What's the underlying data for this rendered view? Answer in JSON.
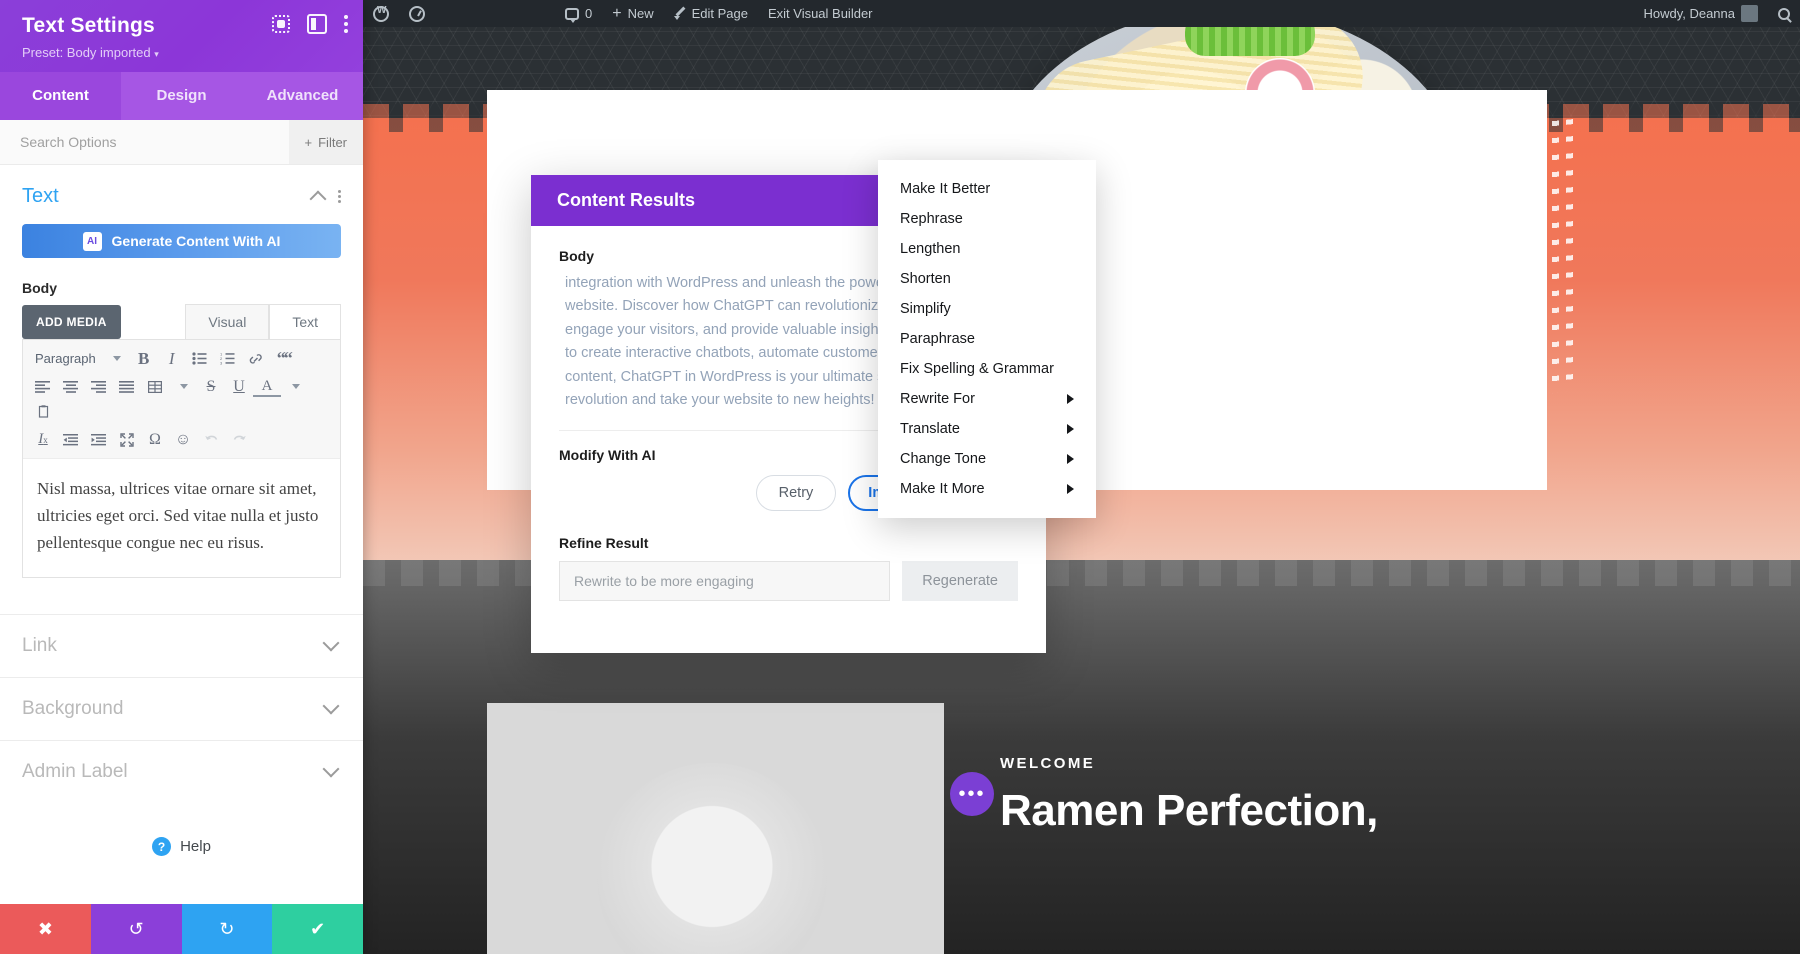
{
  "wp_admin_bar": {
    "wp_logo_icon": "wordpress-logo-icon",
    "speed_icon": "speed-gauge-icon",
    "comments_count": "0",
    "new_label": "New",
    "edit_page_label": "Edit Page",
    "exit_builder_label": "Exit Visual Builder",
    "howdy_label": "Howdy, Deanna",
    "search_icon": "search-icon",
    "avatar_icon": "avatar-icon"
  },
  "panel": {
    "title": "Text Settings",
    "preset": "Preset: Body imported",
    "preset_caret": "▾",
    "header_icons": [
      "focus-icon",
      "layout-toggle-icon",
      "kebab-menu-icon"
    ],
    "tabs": [
      {
        "label": "Content",
        "active": true
      },
      {
        "label": "Design",
        "active": false
      },
      {
        "label": "Advanced",
        "active": false
      }
    ],
    "search": {
      "placeholder": "Search Options",
      "value": ""
    },
    "filter_label": "Filter",
    "filter_icon": "plus-icon",
    "section": {
      "title": "Text",
      "collapse_icon": "chevron-up-icon",
      "kebab_icon": "kebab-menu-icon"
    },
    "ai_button": {
      "label": "Generate Content With AI",
      "badge": "AI"
    },
    "body_label": "Body",
    "add_media_label": "ADD MEDIA",
    "editor_tabs": [
      {
        "label": "Visual",
        "active": true
      },
      {
        "label": "Text",
        "active": false
      }
    ],
    "toolbar_row1": [
      {
        "name": "paragraph-format-select",
        "label": "Paragraph",
        "type": "select"
      },
      {
        "name": "bold-icon",
        "label": "B",
        "type": "bold"
      },
      {
        "name": "italic-icon",
        "label": "I",
        "type": "italic"
      },
      {
        "name": "bulleted-list-icon",
        "label": "☰",
        "type": "ul"
      },
      {
        "name": "numbered-list-icon",
        "label": "☰",
        "type": "ol"
      },
      {
        "name": "link-icon",
        "label": "🔗",
        "type": "link"
      },
      {
        "name": "blockquote-icon",
        "label": "“",
        "type": "quote"
      }
    ],
    "toolbar_row2": [
      {
        "name": "align-left-icon",
        "label": "≡"
      },
      {
        "name": "align-center-icon",
        "label": "≡"
      },
      {
        "name": "align-right-icon",
        "label": "≡"
      },
      {
        "name": "align-justify-icon",
        "label": "≡"
      },
      {
        "name": "table-icon",
        "label": "▦"
      },
      {
        "name": "strikethrough-icon",
        "label": "S"
      },
      {
        "name": "underline-icon",
        "label": "U"
      },
      {
        "name": "text-color-icon",
        "label": "A"
      },
      {
        "name": "paste-icon",
        "label": "📋"
      }
    ],
    "toolbar_row3": [
      {
        "name": "clear-formatting-icon",
        "label": "Iₓ"
      },
      {
        "name": "outdent-icon",
        "label": "⇤"
      },
      {
        "name": "indent-icon",
        "label": "⇥"
      },
      {
        "name": "fullscreen-icon",
        "label": "⤡"
      },
      {
        "name": "special-character-icon",
        "label": "Ω"
      },
      {
        "name": "emoji-icon",
        "label": "☺"
      },
      {
        "name": "undo-icon",
        "label": "↶"
      },
      {
        "name": "redo-icon",
        "label": "↷"
      }
    ],
    "editor_content": "Nisl massa, ultrices vitae ornare sit amet, ultricies eget orci. Sed vitae nulla et justo pellentesque congue nec eu risus.",
    "accordions": [
      {
        "label": "Link"
      },
      {
        "label": "Background"
      },
      {
        "label": "Admin Label"
      }
    ],
    "help_label": "Help",
    "help_icon": "question-circle-icon",
    "actions": [
      {
        "name": "cancel-button",
        "icon": "close-icon",
        "glyph": "✖",
        "color": "#eb5a5a"
      },
      {
        "name": "undo-button",
        "icon": "undo-icon",
        "glyph": "↺",
        "color": "#8b3fd9"
      },
      {
        "name": "redo-button",
        "icon": "redo-icon",
        "glyph": "↻",
        "color": "#2ea3f2"
      },
      {
        "name": "save-button",
        "icon": "checkmark-icon",
        "glyph": "✔",
        "color": "#2ecfa0"
      }
    ]
  },
  "modal": {
    "title": "Content Results",
    "body_label": "Body",
    "result_text": "integration with WordPress and unleash the power of website. Discover how ChatGPT can revolutionize your engage your visitors, and provide valuable insights. Wh to create interactive chatbots, automate customer sup content, ChatGPT in WordPress is your ultimate solutio revolution and take your website to new heights!",
    "result_lines": [
      "integration with WordPress and unleash the power of",
      "website. Discover how ChatGPT can revolutionize your",
      "engage your visitors, and provide valuable insights. Wh",
      "to create interactive chatbots, automate customer sup",
      "content, ChatGPT in WordPress is your ultimate solutio",
      "revolution and take your website to new heights!"
    ],
    "modify_label": "Modify With AI",
    "retry_label": "Retry",
    "improve_label": "Improve With AI",
    "improve_caret": "▾",
    "refine_label": "Refine Result",
    "refine_placeholder": "Rewrite to be more engaging",
    "refine_value": "",
    "regenerate_label": "Regenerate"
  },
  "ai_menu": {
    "items": [
      {
        "label": "Make It Better",
        "submenu": false
      },
      {
        "label": "Rephrase",
        "submenu": false
      },
      {
        "label": "Lengthen",
        "submenu": false
      },
      {
        "label": "Shorten",
        "submenu": false
      },
      {
        "label": "Simplify",
        "submenu": false
      },
      {
        "label": "Paraphrase",
        "submenu": false
      },
      {
        "label": "Fix Spelling & Grammar",
        "submenu": false
      },
      {
        "label": "Rewrite For",
        "submenu": true
      },
      {
        "label": "Translate",
        "submenu": true
      },
      {
        "label": "Change Tone",
        "submenu": true
      },
      {
        "label": "Make It More",
        "submenu": true
      }
    ]
  },
  "page_preview": {
    "welcome_kicker": "WELCOME",
    "welcome_title": "Ramen Perfection,",
    "dots_icon": "ellipsis-icon"
  },
  "colors": {
    "divi_purple": "#8b3fd9",
    "modal_purple": "#7b2fd0",
    "accent_blue": "#2ea3f2",
    "primary_blue": "#1a73e8",
    "danger": "#eb5a5a",
    "success": "#2ecfa0"
  }
}
